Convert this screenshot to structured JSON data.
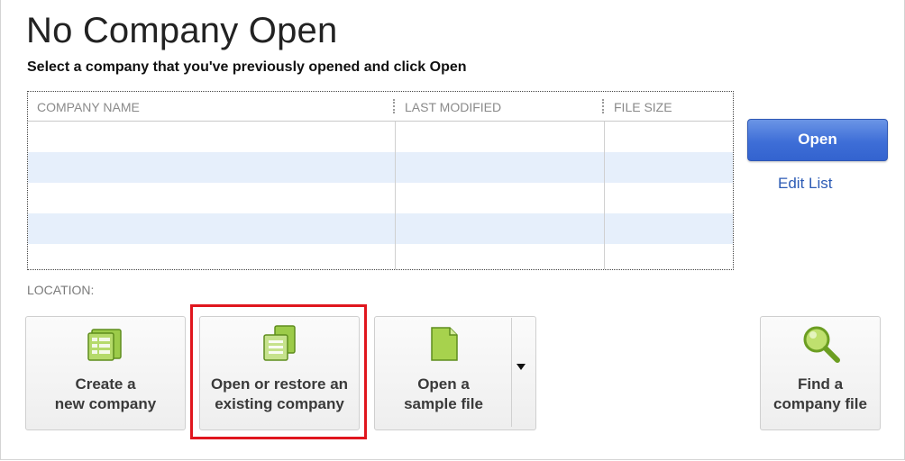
{
  "header": {
    "title": "No Company Open",
    "subtitle": "Select a company that you've previously opened and click Open"
  },
  "table": {
    "columns": [
      "COMPANY NAME",
      "LAST MODIFIED",
      "FILE SIZE"
    ],
    "rows": []
  },
  "actions": {
    "open_label": "Open",
    "edit_list_label": "Edit List"
  },
  "location": {
    "label": "LOCATION:"
  },
  "tiles": {
    "create": {
      "line1": "Create a",
      "line2": "new company",
      "icon": "company-grid-icon"
    },
    "restore": {
      "line1": "Open or restore an",
      "line2": "existing company",
      "icon": "open-folder-icon"
    },
    "sample": {
      "line1": "Open a",
      "line2": "sample file",
      "icon": "sample-file-icon"
    },
    "find": {
      "line1": "Find a",
      "line2": "company file",
      "icon": "magnifier-icon"
    }
  },
  "colors": {
    "accent_blue": "#3e6ed7",
    "row_alt": "#e6effb",
    "highlight_red": "#e0161e",
    "icon_green": "#8fc43c"
  }
}
